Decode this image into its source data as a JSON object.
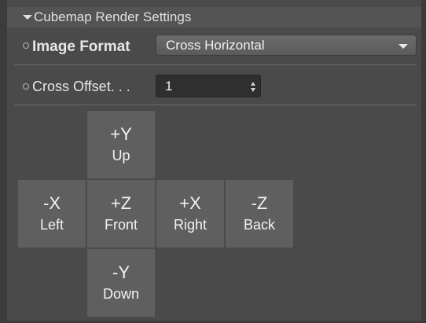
{
  "header": {
    "title": "Cubemap Render Settings"
  },
  "image_format": {
    "label": "Image Format",
    "value": "Cross Horizontal"
  },
  "cross_offset": {
    "label": "Cross Offset. . .",
    "value": "1"
  },
  "cube_faces": [
    {
      "axis": "+Y",
      "name": "Up"
    },
    {
      "axis": "-X",
      "name": "Left"
    },
    {
      "axis": "+Z",
      "name": "Front"
    },
    {
      "axis": "+X",
      "name": "Right"
    },
    {
      "axis": "-Z",
      "name": "Back"
    },
    {
      "axis": "-Y",
      "name": "Down"
    }
  ]
}
